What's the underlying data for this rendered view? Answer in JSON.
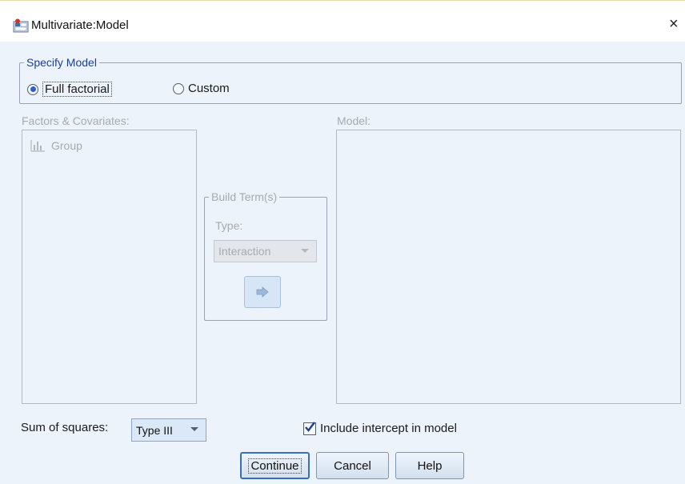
{
  "window": {
    "title": "Multivariate:Model",
    "close_glyph": "×"
  },
  "specify_model": {
    "legend": "Specify Model",
    "full_factorial_label": "Full factorial",
    "custom_label": "Custom",
    "selected": "Full factorial"
  },
  "factors": {
    "label": "Factors & Covariates:",
    "items": [
      {
        "name": "Group",
        "icon": "nominal-scale-icon"
      }
    ]
  },
  "model": {
    "label": "Model:"
  },
  "build_terms": {
    "legend": "Build Term(s)",
    "type_label": "Type:",
    "type_value": "Interaction",
    "arrow_icon": "move-right-arrow-icon"
  },
  "sum_of_squares": {
    "label": "Sum of squares:",
    "value": "Type III"
  },
  "include_intercept": {
    "label": "Include intercept in model",
    "checked": true
  },
  "buttons": {
    "continue": "Continue",
    "cancel": "Cancel",
    "help": "Help"
  },
  "colors": {
    "client_bg": "#edf3fb",
    "accent": "#1b3f94",
    "disabled_text": "#a7abb1"
  }
}
